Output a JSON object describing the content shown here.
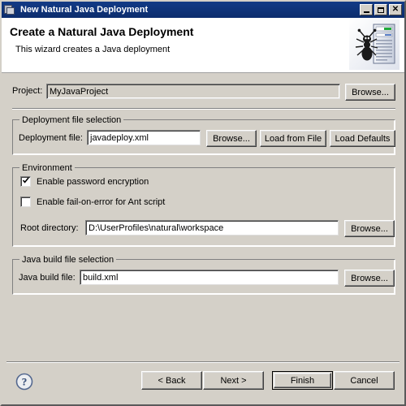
{
  "window": {
    "title": "New Natural Java Deployment",
    "icon": "window-cascade-icon",
    "controls": {
      "minimize": "minimize-button",
      "maximize": "maximize-button",
      "close": "close-button"
    }
  },
  "header": {
    "title": "Create a Natural Java Deployment",
    "subtitle": "This wizard creates a Java deployment",
    "icon": "ant-deployment-icon"
  },
  "project": {
    "label": "Project:",
    "value": "MyJavaProject",
    "browse_label": "Browse...",
    "enabled": false
  },
  "deployment_group": {
    "title": "Deployment file selection",
    "file_label": "Deployment file:",
    "file_value": "javadeploy.xml",
    "browse_label": "Browse...",
    "load_from_file_label": "Load from File",
    "load_defaults_label": "Load Defaults"
  },
  "environment_group": {
    "title": "Environment",
    "checkbox_password": {
      "label": "Enable password encryption",
      "checked": true
    },
    "checkbox_failonerror": {
      "label": "Enable fail-on-error for Ant script",
      "checked": false
    },
    "root_dir_label": "Root directory:",
    "root_dir_value": "D:\\UserProfiles\\natural\\workspace",
    "browse_label": "Browse..."
  },
  "build_group": {
    "title": "Java build file selection",
    "file_label": "Java build file:",
    "file_value": "build.xml",
    "browse_label": "Browse..."
  },
  "footer": {
    "help_icon": "help-icon",
    "back_label": "< Back",
    "next_label": "Next >",
    "finish_label": "Finish",
    "cancel_label": "Cancel",
    "default_button": "Finish"
  },
  "colors": {
    "dialog_bg": "#d4d0c8",
    "titlebar_start": "#123a86",
    "titlebar_end": "#0c2d6d",
    "titlebar_text": "#ffffff",
    "field_bg": "#ffffff",
    "border_shadow": "#808080",
    "border_light": "#ffffff",
    "help_blue": "#4a6campos"
  }
}
